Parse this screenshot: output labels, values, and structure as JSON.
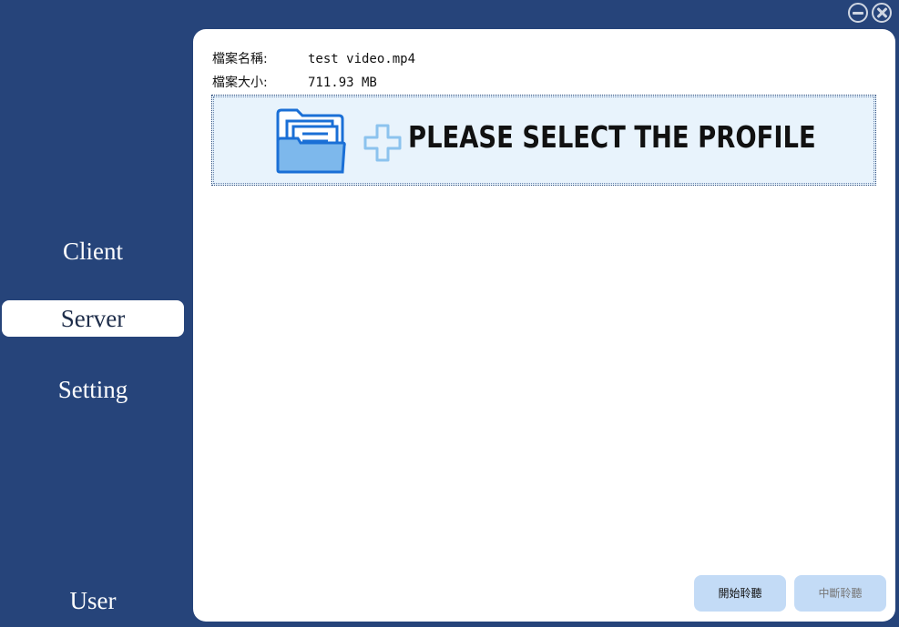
{
  "window": {
    "minimize_icon": "minus-circle-icon",
    "close_icon": "x-circle-icon"
  },
  "sidebar": {
    "items": [
      {
        "label": "Client",
        "active": false
      },
      {
        "label": "Server",
        "active": true
      },
      {
        "label": "Setting",
        "active": false
      }
    ],
    "user_label": "User"
  },
  "file_info": {
    "name_label": "檔案名稱:",
    "name_value": "test video.mp4",
    "size_label": "檔案大小:",
    "size_value": "711.93 MB"
  },
  "dropzone": {
    "text": "PLEASE SELECT THE PROFILE",
    "folder_icon": "open-folder-icon",
    "plus_icon": "plus-icon"
  },
  "buttons": {
    "start_label": "開始聆聽",
    "stop_label": "中斷聆聽"
  },
  "colors": {
    "background": "#26447a",
    "panel": "#ffffff",
    "dropzone_bg": "#e8f3fc",
    "button_bg": "#c3dbf6",
    "icon_blue": "#1a73e8"
  }
}
